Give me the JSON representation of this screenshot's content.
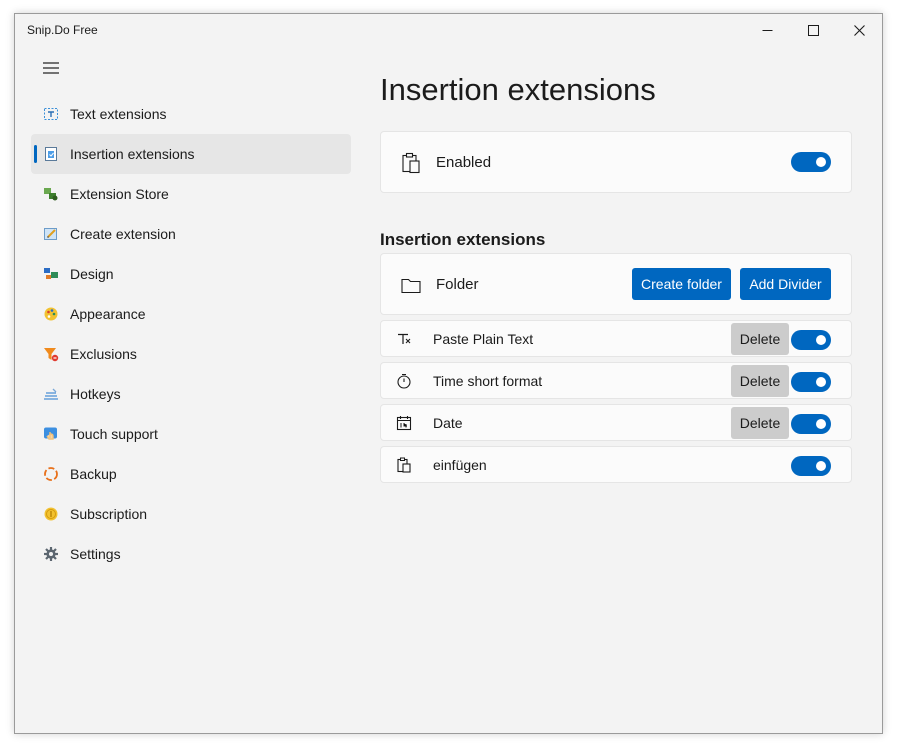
{
  "window": {
    "title": "Snip.Do Free"
  },
  "colors": {
    "accent": "#0067c0",
    "window_bg": "#f3f3f3",
    "card_bg": "#fbfbfb",
    "delete_bg": "#cccccc"
  },
  "nav": {
    "selected_index": 1,
    "items": [
      {
        "label": "Text extensions",
        "icon": "text-extensions-icon"
      },
      {
        "label": "Insertion extensions",
        "icon": "insertion-extensions-icon"
      },
      {
        "label": "Extension Store",
        "icon": "extension-store-icon"
      },
      {
        "label": "Create extension",
        "icon": "create-extension-icon"
      },
      {
        "label": "Design",
        "icon": "design-icon"
      },
      {
        "label": "Appearance",
        "icon": "appearance-icon"
      },
      {
        "label": "Exclusions",
        "icon": "exclusions-icon"
      },
      {
        "label": "Hotkeys",
        "icon": "hotkeys-icon"
      },
      {
        "label": "Touch support",
        "icon": "touch-support-icon"
      },
      {
        "label": "Backup",
        "icon": "backup-icon"
      },
      {
        "label": "Subscription",
        "icon": "subscription-icon"
      },
      {
        "label": "Settings",
        "icon": "settings-icon"
      }
    ]
  },
  "main": {
    "title": "Insertion extensions",
    "enabled_card": {
      "label": "Enabled",
      "icon": "clipboard-icon",
      "toggle_on": true
    },
    "section_title": "Insertion extensions",
    "folder_card": {
      "label": "Folder",
      "icon": "folder-icon",
      "create_folder_label": "Create folder",
      "add_divider_label": "Add Divider"
    },
    "extensions": [
      {
        "label": "Paste Plain Text",
        "icon": "clear-format-icon",
        "delete_label": "Delete",
        "enabled": true
      },
      {
        "label": "Time short format",
        "icon": "stopwatch-icon",
        "delete_label": "Delete",
        "enabled": true
      },
      {
        "label": "Date",
        "icon": "calendar-icon",
        "delete_label": "Delete",
        "enabled": true
      },
      {
        "label": "einfügen",
        "icon": "paste-icon",
        "enabled": true
      }
    ]
  }
}
